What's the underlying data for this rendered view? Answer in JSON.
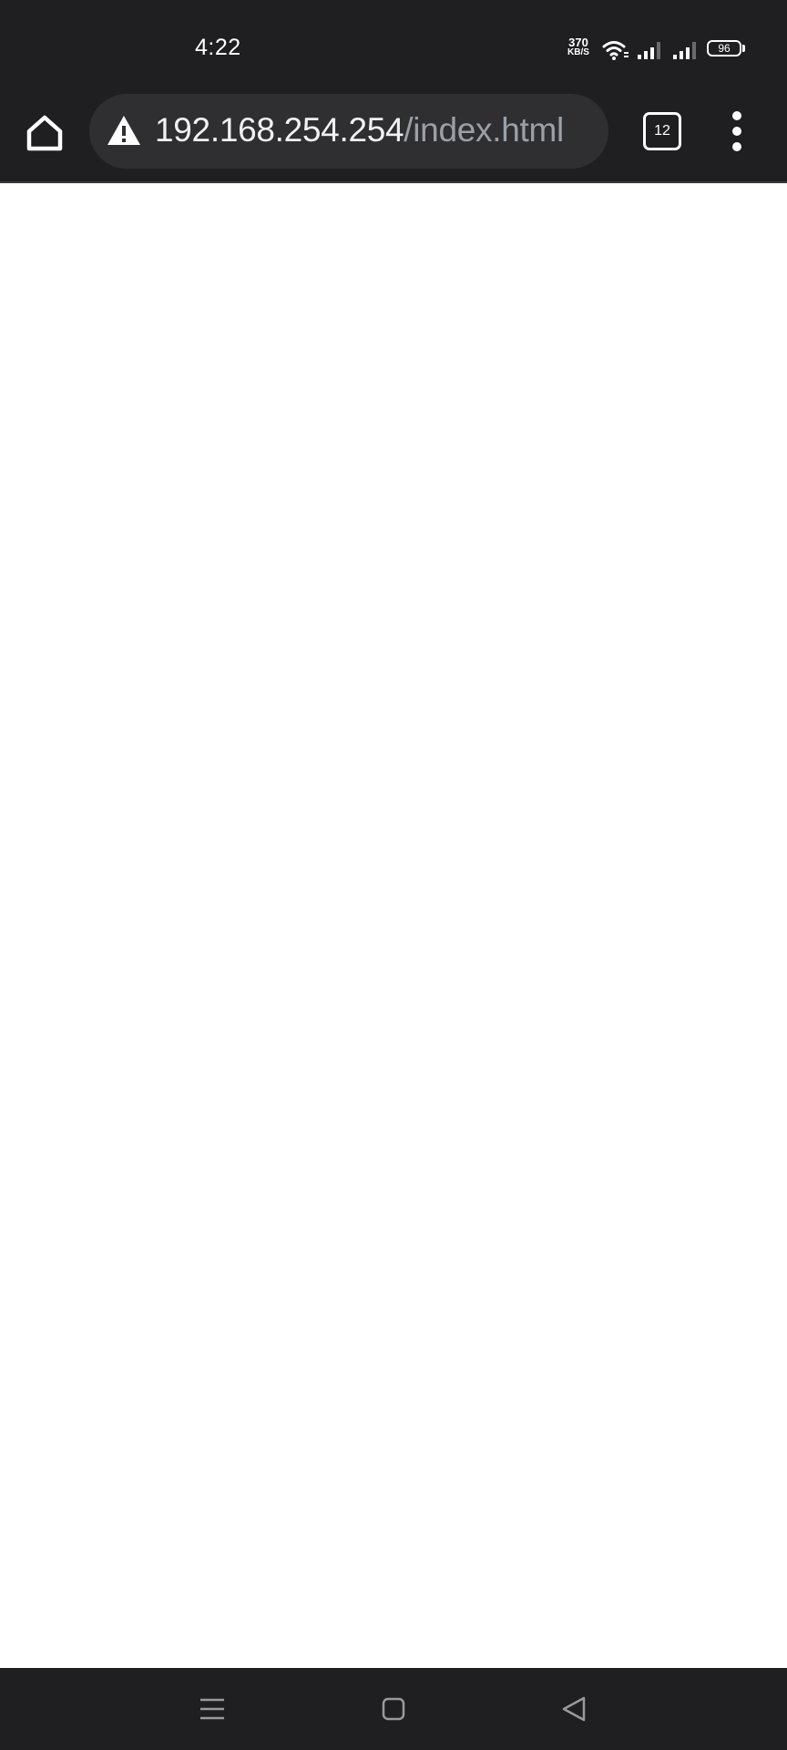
{
  "status_bar": {
    "time": "4:22",
    "network_speed": {
      "value": "370",
      "unit": "KB/S"
    },
    "battery_level": "96",
    "icons": [
      "wifi-icon",
      "signal-icon-sim1",
      "signal-icon-sim2",
      "battery-icon"
    ]
  },
  "toolbar": {
    "home_icon": "home-icon",
    "security_icon": "warning-icon",
    "url_host": "192.168.254.254",
    "url_path": "/index.html",
    "tab_count": "12",
    "menu_icon": "more-vertical-icon"
  },
  "nav_bar": {
    "buttons": [
      "recents-icon",
      "home-icon",
      "back-icon"
    ]
  },
  "colors": {
    "chrome_background": "#1f1f21",
    "url_bar_background": "#2f2f32",
    "url_host_text": "#f1f1f1",
    "url_path_text": "#9aa0a6",
    "page_background": "#ffffff"
  }
}
